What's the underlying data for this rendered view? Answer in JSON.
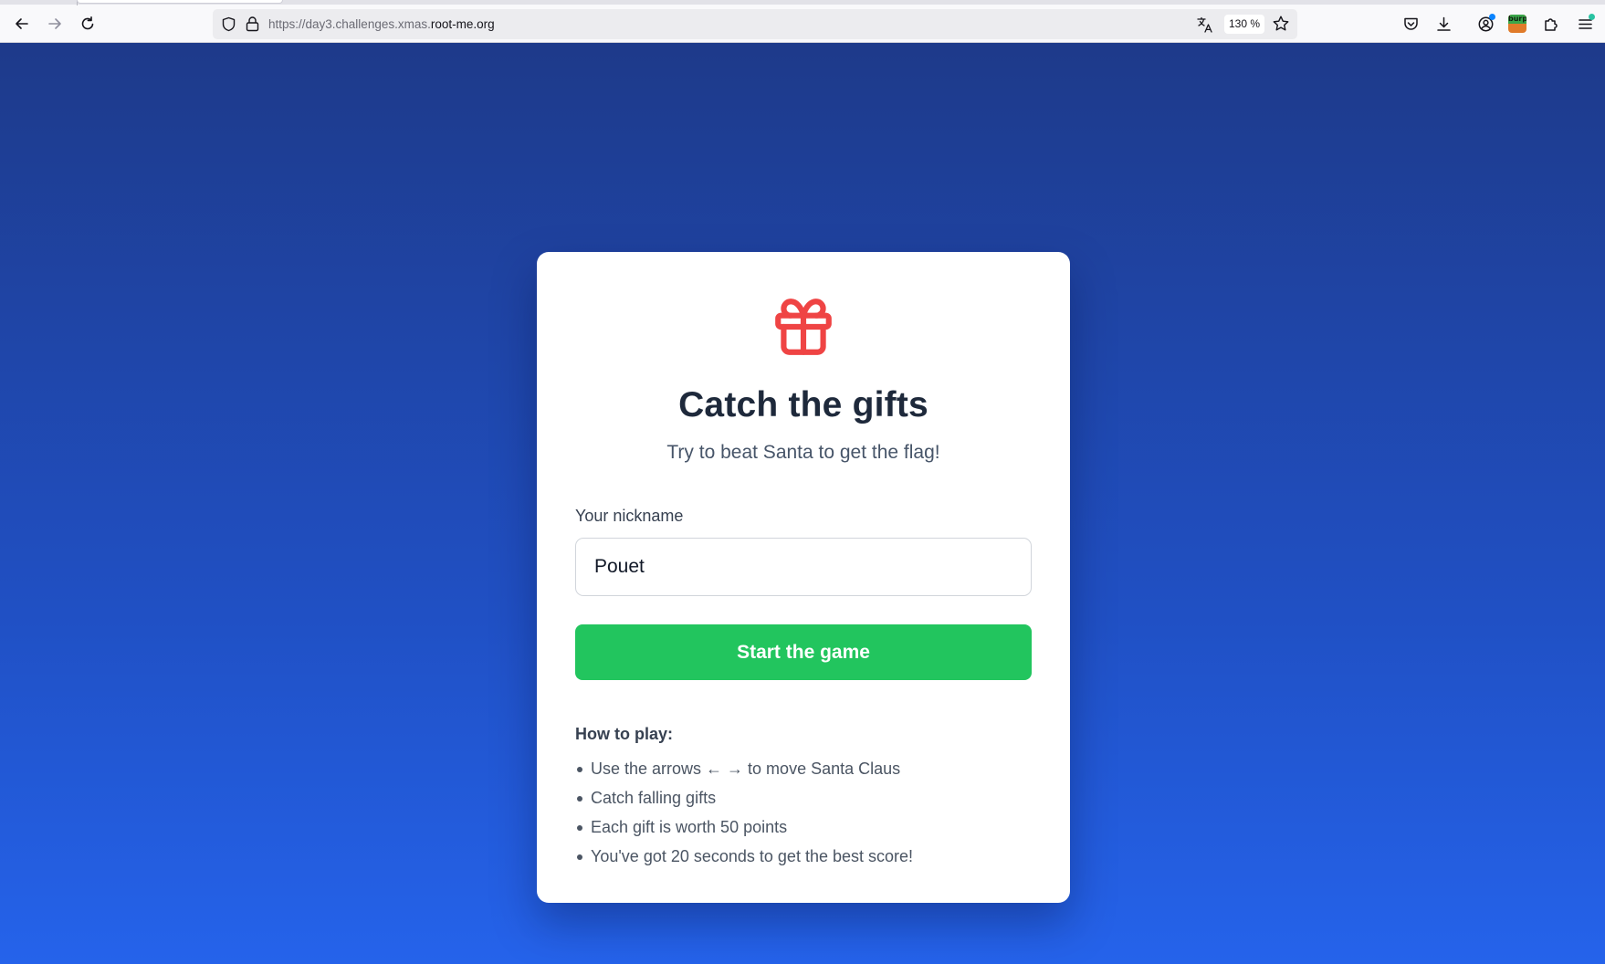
{
  "browser": {
    "url_prefix": "https://day3.challenges.xmas.",
    "url_host": "root-me.org",
    "zoom_level": "130 %",
    "extension_label": "burp",
    "icons": {
      "back": "arrow-left-icon",
      "forward": "arrow-right-icon",
      "reload": "reload-icon",
      "tracking_protection": "shield-icon",
      "connection": "lock-icon",
      "translate": "translate-icon",
      "bookmark": "star-icon",
      "pocket": "pocket-icon",
      "downloads": "download-icon",
      "account": "account-icon",
      "extensions": "puzzle-icon",
      "menu": "hamburger-menu-icon"
    },
    "colors": {
      "account_badge": "#0a84ff",
      "menu_badge": "#2ac3a2"
    }
  },
  "page": {
    "title": "Catch the gifts",
    "subtitle": "Try to beat Santa to get the flag!",
    "form": {
      "nickname_label": "Your nickname",
      "nickname_value": "Pouet",
      "start_label": "Start the game"
    },
    "how_to_play": {
      "heading": "How to play:",
      "rules": [
        "Use the arrows ← → to move Santa Claus",
        "Catch falling gifts",
        "Each gift is worth 50 points",
        "You've got 20 seconds to get the best score!"
      ]
    },
    "icons": {
      "hero": "gift-icon"
    },
    "colors": {
      "background_top": "#1e3a8a",
      "background_bottom": "#2563eb",
      "gift": "#ef4444",
      "start_button": "#22c55e",
      "title": "#1e293b"
    }
  }
}
